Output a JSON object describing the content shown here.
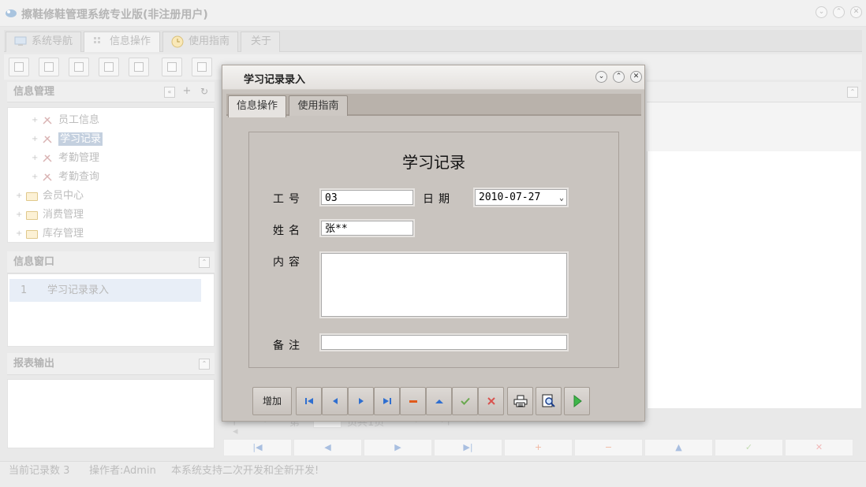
{
  "app": {
    "title": "擦鞋修鞋管理系统专业版(非注册用户)"
  },
  "main_tabs": [
    {
      "label": "系统导航"
    },
    {
      "label": "信息操作"
    },
    {
      "label": "使用指南"
    },
    {
      "label": "关于"
    }
  ],
  "info_panel": {
    "title": "信息管理",
    "tree": [
      {
        "label": "员工信息",
        "kind": "leaf"
      },
      {
        "label": "学习记录",
        "kind": "leaf",
        "selected": true
      },
      {
        "label": "考勤管理",
        "kind": "leaf"
      },
      {
        "label": "考勤查询",
        "kind": "leaf"
      },
      {
        "label": "会员中心",
        "kind": "folder"
      },
      {
        "label": "消费管理",
        "kind": "folder"
      },
      {
        "label": "库存管理",
        "kind": "folder"
      }
    ]
  },
  "window_panel": {
    "title": "信息窗口",
    "rows": [
      {
        "no": "1",
        "name": "学习记录录入"
      }
    ]
  },
  "report_panel": {
    "title": "报表输出"
  },
  "pager": {
    "prefix": "第",
    "suffix": "页共1页"
  },
  "statusbar": {
    "record_count": "当前记录数 3",
    "operator": "操作者:Admin",
    "message": "本系统支持二次开发和全新开发!"
  },
  "dialog": {
    "title": "学习记录录入",
    "tabs": [
      {
        "label": "信息操作"
      },
      {
        "label": "使用指南"
      }
    ],
    "form": {
      "heading": "学习记录",
      "employee_id_label": "工号",
      "employee_id_value": "03",
      "date_label": "日期",
      "date_value": "2010-07-27",
      "name_label": "姓名",
      "name_value": "张**",
      "content_label": "内容",
      "content_value": "",
      "remark_label": "备注",
      "remark_value": ""
    },
    "buttons": {
      "add_label": "增加"
    }
  },
  "colors": {
    "dialog_bg": "#c9c4bf",
    "nav_blue": "#2f6fd0",
    "delete_red": "#e05a1c",
    "confirm_green": "#6aa84f",
    "cancel_red": "#d9534f",
    "run_green": "#3fb64a"
  },
  "icons": {
    "first": "first-record-icon",
    "prev": "prev-record-icon",
    "next": "next-record-icon",
    "last": "last-record-icon",
    "delete": "minus-icon",
    "edit": "triangle-up-icon",
    "save": "check-icon",
    "cancel": "x-icon",
    "print": "printer-icon",
    "preview": "print-preview-icon",
    "run": "play-icon"
  }
}
